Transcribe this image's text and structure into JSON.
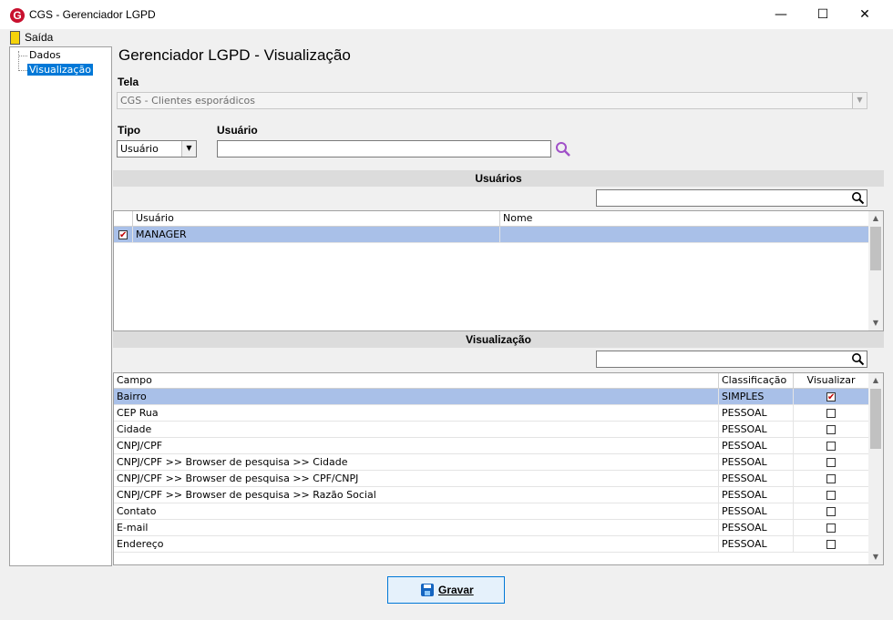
{
  "window": {
    "title": "CGS - Gerenciador LGPD",
    "minimize": "—",
    "maximize": "☐",
    "close": "✕"
  },
  "menu": {
    "exit_label": "Saída"
  },
  "tree": {
    "items": [
      {
        "label": "Dados"
      },
      {
        "label": "Visualização"
      }
    ]
  },
  "page": {
    "title": "Gerenciador LGPD - Visualização"
  },
  "form": {
    "tela_label": "Tela",
    "tela_value": "CGS - Clientes esporádicos",
    "tipo_label": "Tipo",
    "tipo_value": "Usuário",
    "usuario_label": "Usuário",
    "usuario_value": ""
  },
  "users_section": {
    "title": "Usuários",
    "search_value": "",
    "columns": [
      "Usuário",
      "Nome"
    ],
    "rows": [
      {
        "checked": true,
        "usuario": "MANAGER",
        "nome": ""
      }
    ]
  },
  "view_section": {
    "title": "Visualização",
    "search_value": "",
    "columns": [
      "Campo",
      "Classificação",
      "Visualizar"
    ],
    "rows": [
      {
        "campo": "Bairro",
        "classificacao": "SIMPLES",
        "visualizar": true
      },
      {
        "campo": "CEP Rua",
        "classificacao": "PESSOAL",
        "visualizar": false
      },
      {
        "campo": "Cidade",
        "classificacao": "PESSOAL",
        "visualizar": false
      },
      {
        "campo": "CNPJ/CPF",
        "classificacao": "PESSOAL",
        "visualizar": false
      },
      {
        "campo": "CNPJ/CPF >> Browser de pesquisa >> Cidade",
        "classificacao": "PESSOAL",
        "visualizar": false
      },
      {
        "campo": "CNPJ/CPF >> Browser de pesquisa >> CPF/CNPJ",
        "classificacao": "PESSOAL",
        "visualizar": false
      },
      {
        "campo": "CNPJ/CPF >> Browser de pesquisa >> Razão Social",
        "classificacao": "PESSOAL",
        "visualizar": false
      },
      {
        "campo": "Contato",
        "classificacao": "PESSOAL",
        "visualizar": false
      },
      {
        "campo": "E-mail",
        "classificacao": "PESSOAL",
        "visualizar": false
      },
      {
        "campo": "Endereço",
        "classificacao": "PESSOAL",
        "visualizar": false
      }
    ]
  },
  "footer": {
    "save_label": "Gravar"
  },
  "icons": {
    "app": "cgs-logo-icon",
    "search": "search-icon",
    "save": "floppy-disk-icon",
    "exit": "door-exit-icon"
  },
  "colors": {
    "selection": "#a9c0e8",
    "check": "#c00000",
    "search_icon_purple": "#a050c8"
  }
}
